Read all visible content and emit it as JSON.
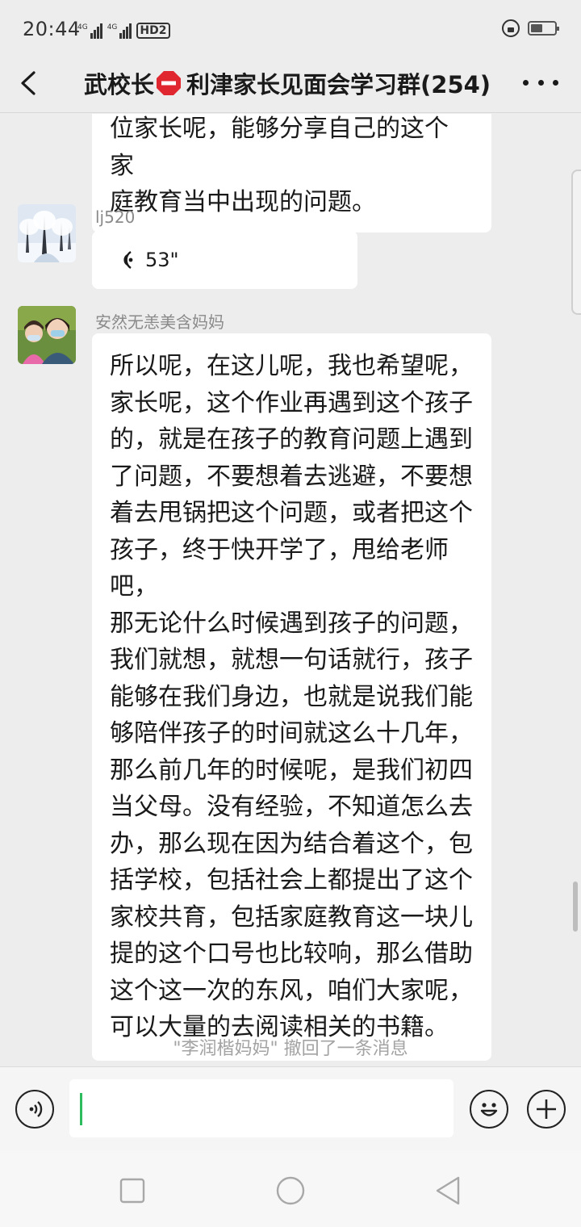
{
  "status_bar": {
    "time": "20:44",
    "signal_1_label": "4G",
    "signal_2_label": "4G",
    "hd_label": "HD2",
    "battery_level": 0.5
  },
  "header": {
    "title_prefix": "武校长",
    "title_suffix": "利津家长见面会学习群(254)",
    "title_icon": "stop-sign-emoji",
    "back_icon": "chevron-left-icon",
    "more_icon": "more-dots-icon"
  },
  "messages": {
    "partial": {
      "text": "位家长呢，能够分享自己的这个家\n庭教育当中出现的问题。"
    },
    "voice": {
      "sender": "lj520",
      "duration": "53\"",
      "avatar": "snowy-trees-avatar"
    },
    "long": {
      "sender": "安然无恙美含妈妈",
      "avatar": "mother-child-avatar",
      "text": "所以呢，在这儿呢，我也希望呢，\n家长呢，这个作业再遇到这个孩子\n的，就是在孩子的教育问题上遇到\n了问题，不要想着去逃避，不要想\n着去甩锅把这个问题，或者把这个\n孩子，终于快开学了，甩给老师吧，\n那无论什么时候遇到孩子的问题，\n我们就想，就想一句话就行，孩子\n能够在我们身边，也就是说我们能\n够陪伴孩子的时间就这么十几年，\n那么前几年的时候呢，是我们初四\n当父母。没有经验，不知道怎么去\n办，那么现在因为结合着这个，包\n括学校，包括社会上都提出了这个\n家校共育，包括家庭教育这一块儿\n提的这个口号也比较响，那么借助\n这个这一次的东风，咱们大家呢，\n可以大量的去阅读相关的书籍。"
    },
    "system": "\"李润楷妈妈\" 撤回了一条消息"
  },
  "input_bar": {
    "value": "",
    "voice_icon": "voice-mode-icon",
    "emoji_icon": "emoji-icon",
    "plus_icon": "plus-icon",
    "caret_color": "#2dbb5d"
  },
  "nav_bar": {
    "recent_icon": "square-recent-icon",
    "home_icon": "circle-home-icon",
    "back_icon": "triangle-back-icon"
  }
}
